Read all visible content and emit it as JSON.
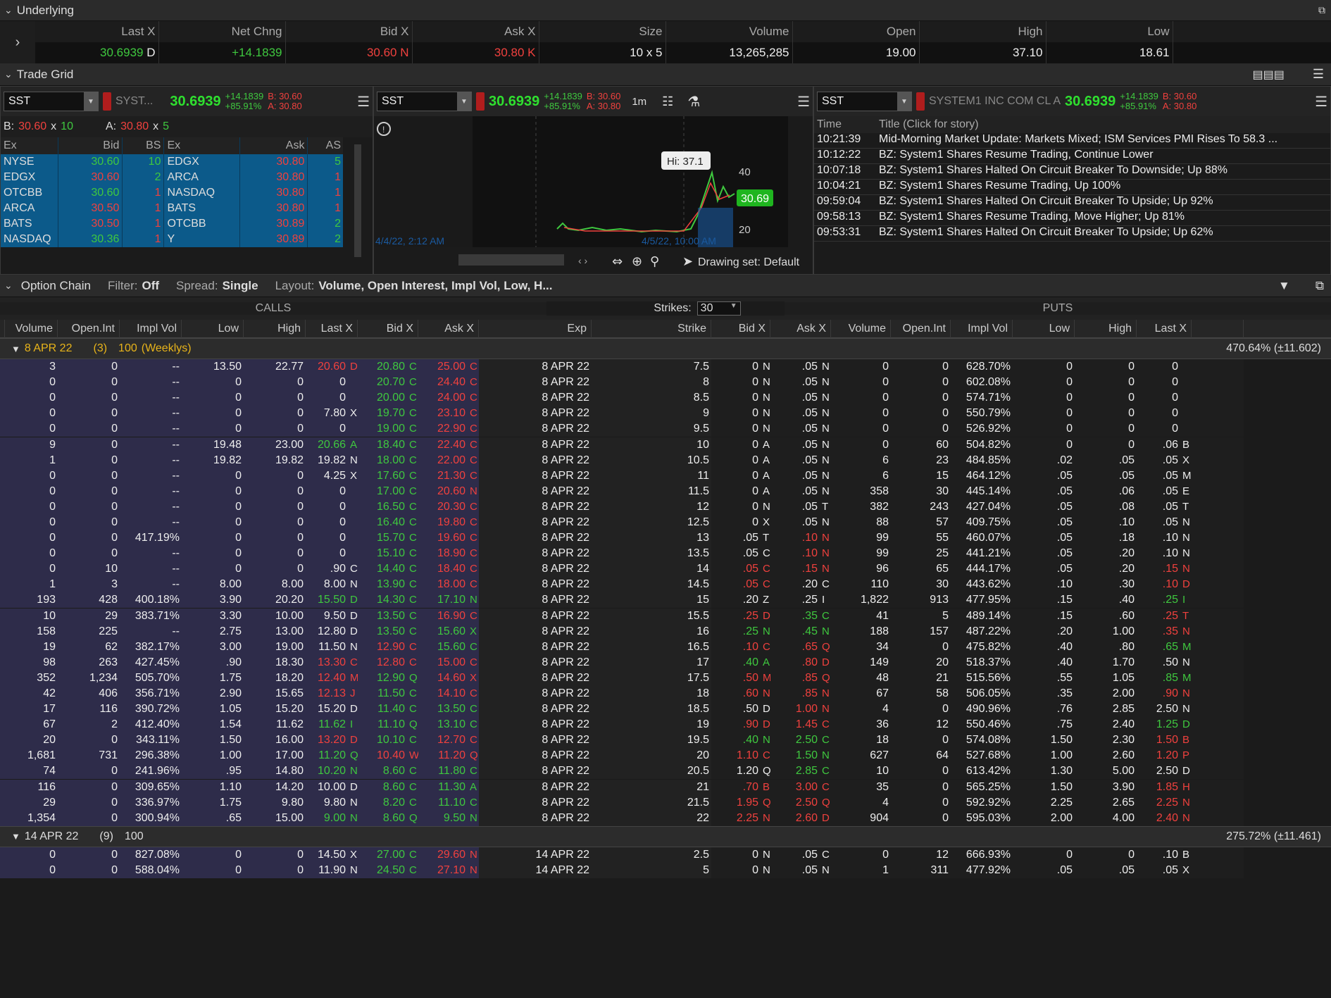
{
  "underlying": {
    "title": "Underlying",
    "headers": [
      "Last X",
      "Net Chng",
      "Bid X",
      "Ask X",
      "Size",
      "Volume",
      "Open",
      "High",
      "Low"
    ],
    "last": "30.6939",
    "last_ex": "D",
    "net_chng": "+14.1839",
    "bid": "30.60",
    "bid_ex": "N",
    "ask": "30.80",
    "ask_ex": "K",
    "size": "10 x 5",
    "volume": "13,265,285",
    "open": "19.00",
    "high": "37.10",
    "low": "18.61"
  },
  "trade_grid": {
    "title": "Trade Grid"
  },
  "level2": {
    "symbol": "SST",
    "name": "SYST...",
    "price": "30.6939",
    "chg": "+14.1839",
    "pct": "+85.91%",
    "b": "B: 30.60",
    "a": "A: 30.80",
    "bid_label": "B:",
    "bid_val": "30.60",
    "bid_x": "x",
    "bid_size": "10",
    "ask_label": "A:",
    "ask_val": "30.80",
    "ask_x": "x",
    "ask_size": "5",
    "headers": [
      "Ex",
      "Bid",
      "BS",
      "Ex",
      "Ask",
      "AS"
    ],
    "rows": [
      [
        "NYSE",
        "30.60",
        "10",
        "EDGX",
        "30.80",
        "5"
      ],
      [
        "EDGX",
        "30.60",
        "2",
        "ARCA",
        "30.80",
        "1"
      ],
      [
        "OTCBB",
        "30.60",
        "1",
        "NASDAQ",
        "30.80",
        "1"
      ],
      [
        "ARCA",
        "30.50",
        "1",
        "BATS",
        "30.80",
        "1"
      ],
      [
        "BATS",
        "30.50",
        "1",
        "OTCBB",
        "30.89",
        "2"
      ],
      [
        "NASDAQ",
        "30.36",
        "1",
        "Y",
        "30.89",
        "2"
      ]
    ]
  },
  "chart": {
    "symbol": "SST",
    "price": "30.6939",
    "chg": "+14.1839",
    "pct": "+85.91%",
    "b": "B: 30.60",
    "a": "A: 30.80",
    "interval": "1m",
    "hi_label": "Hi: 37.1",
    "y40": "40",
    "y20": "20",
    "last_tag": "30.69",
    "date1": "4/4/22, 2:12 AM",
    "date2": "4/5/22, 10:00 AM",
    "drawing": "Drawing set: Default"
  },
  "news": {
    "symbol": "SST",
    "name": "SYSTEM1 INC COM CL A",
    "price": "30.6939",
    "chg": "+14.1839",
    "pct": "+85.91%",
    "b": "B: 30.60",
    "a": "A: 30.80",
    "h_time": "Time",
    "h_title": "Title (Click for story)",
    "items": [
      [
        "10:21:39",
        "Mid-Morning Market Update: Markets Mixed; ISM Services PMI Rises To 58.3 ..."
      ],
      [
        "10:12:22",
        "BZ: System1 Shares Resume Trading, Continue Lower"
      ],
      [
        "10:07:18",
        "BZ: System1 Shares Halted On Circuit Breaker To Downside; Up 88%"
      ],
      [
        "10:04:21",
        "BZ: System1 Shares Resume Trading, Up 100%"
      ],
      [
        "09:59:04",
        "BZ: System1 Shares Halted On Circuit Breaker To Upside; Up 92%"
      ],
      [
        "09:58:13",
        "BZ: System1 Shares Resume Trading, Move Higher; Up 81%"
      ],
      [
        "09:53:31",
        "BZ: System1 Shares Halted On Circuit Breaker To Upside; Up 62%"
      ]
    ]
  },
  "option_chain": {
    "title": "Option Chain",
    "filter_label": "Filter:",
    "filter": "Off",
    "spread_label": "Spread:",
    "spread": "Single",
    "layout_label": "Layout:",
    "layout": "Volume, Open Interest, Impl Vol, Low, H...",
    "calls": "CALLS",
    "puts": "PUTS",
    "strikes_label": "Strikes:",
    "strikes": "30",
    "call_headers": [
      "Volume",
      "Open.Int",
      "Impl Vol",
      "Low",
      "High",
      "Last X",
      "Bid X",
      "Ask X"
    ],
    "exp_header": "Exp",
    "strike_header": "Strike",
    "put_headers": [
      "Bid X",
      "Ask X",
      "Volume",
      "Open.Int",
      "Impl Vol",
      "Low",
      "High",
      "Last X"
    ],
    "exp1": {
      "label": "8 APR 22",
      "count": "(3)",
      "mult": "100",
      "weekly": "(Weeklys)",
      "iv": "470.64% (±11.602)"
    },
    "exp2": {
      "label": "14 APR 22",
      "count": "(9)",
      "mult": "100",
      "iv": "275.72% (±11.461)"
    },
    "rows": [
      [
        "3",
        "0",
        "--",
        "13.50",
        "22.77",
        "20.60",
        "D",
        "20.80",
        "C",
        "25.00",
        "C",
        "8 APR 22",
        "7.5",
        "0",
        "N",
        ".05",
        "N",
        "0",
        "0",
        "628.70%",
        "0",
        "0",
        "0",
        ""
      ],
      [
        "0",
        "0",
        "--",
        "0",
        "0",
        "0",
        "",
        "20.70",
        "C",
        "24.40",
        "C",
        "8 APR 22",
        "8",
        "0",
        "N",
        ".05",
        "N",
        "0",
        "0",
        "602.08%",
        "0",
        "0",
        "0",
        ""
      ],
      [
        "0",
        "0",
        "--",
        "0",
        "0",
        "0",
        "",
        "20.00",
        "C",
        "24.00",
        "C",
        "8 APR 22",
        "8.5",
        "0",
        "N",
        ".05",
        "N",
        "0",
        "0",
        "574.71%",
        "0",
        "0",
        "0",
        ""
      ],
      [
        "0",
        "0",
        "--",
        "0",
        "0",
        "7.80",
        "X",
        "19.70",
        "C",
        "23.10",
        "C",
        "8 APR 22",
        "9",
        "0",
        "N",
        ".05",
        "N",
        "0",
        "0",
        "550.79%",
        "0",
        "0",
        "0",
        ""
      ],
      [
        "0",
        "0",
        "--",
        "0",
        "0",
        "0",
        "",
        "19.00",
        "C",
        "22.90",
        "C",
        "8 APR 22",
        "9.5",
        "0",
        "N",
        ".05",
        "N",
        "0",
        "0",
        "526.92%",
        "0",
        "0",
        "0",
        ""
      ],
      [
        "9",
        "0",
        "--",
        "19.48",
        "23.00",
        "20.66",
        "A",
        "18.40",
        "C",
        "22.40",
        "C",
        "8 APR 22",
        "10",
        "0",
        "A",
        ".05",
        "N",
        "0",
        "60",
        "504.82%",
        "0",
        "0",
        ".06",
        "B"
      ],
      [
        "1",
        "0",
        "--",
        "19.82",
        "19.82",
        "19.82",
        "N",
        "18.00",
        "C",
        "22.00",
        "C",
        "8 APR 22",
        "10.5",
        "0",
        "A",
        ".05",
        "N",
        "6",
        "23",
        "484.85%",
        ".02",
        ".05",
        ".05",
        "X"
      ],
      [
        "0",
        "0",
        "--",
        "0",
        "0",
        "4.25",
        "X",
        "17.60",
        "C",
        "21.30",
        "C",
        "8 APR 22",
        "11",
        "0",
        "A",
        ".05",
        "N",
        "6",
        "15",
        "464.12%",
        ".05",
        ".05",
        ".05",
        "M"
      ],
      [
        "0",
        "0",
        "--",
        "0",
        "0",
        "0",
        "",
        "17.00",
        "C",
        "20.60",
        "N",
        "8 APR 22",
        "11.5",
        "0",
        "A",
        ".05",
        "N",
        "358",
        "30",
        "445.14%",
        ".05",
        ".06",
        ".05",
        "E"
      ],
      [
        "0",
        "0",
        "--",
        "0",
        "0",
        "0",
        "",
        "16.50",
        "C",
        "20.30",
        "C",
        "8 APR 22",
        "12",
        "0",
        "N",
        ".05",
        "T",
        "382",
        "243",
        "427.04%",
        ".05",
        ".08",
        ".05",
        "T"
      ],
      [
        "0",
        "0",
        "--",
        "0",
        "0",
        "0",
        "",
        "16.40",
        "C",
        "19.80",
        "C",
        "8 APR 22",
        "12.5",
        "0",
        "X",
        ".05",
        "N",
        "88",
        "57",
        "409.75%",
        ".05",
        ".10",
        ".05",
        "N"
      ],
      [
        "0",
        "0",
        "417.19%",
        "0",
        "0",
        "0",
        "",
        "15.70",
        "C",
        "19.60",
        "C",
        "8 APR 22",
        "13",
        ".05",
        "T",
        ".10",
        "N",
        "99",
        "55",
        "460.07%",
        ".05",
        ".18",
        ".10",
        "N"
      ],
      [
        "0",
        "0",
        "--",
        "0",
        "0",
        "0",
        "",
        "15.10",
        "C",
        "18.90",
        "C",
        "8 APR 22",
        "13.5",
        ".05",
        "C",
        ".10",
        "N",
        "99",
        "25",
        "441.21%",
        ".05",
        ".20",
        ".10",
        "N"
      ],
      [
        "0",
        "10",
        "--",
        "0",
        "0",
        ".90",
        "C",
        "14.40",
        "C",
        "18.40",
        "C",
        "8 APR 22",
        "14",
        ".05",
        "C",
        ".15",
        "N",
        "96",
        "65",
        "444.17%",
        ".05",
        ".20",
        ".15",
        "N"
      ],
      [
        "1",
        "3",
        "--",
        "8.00",
        "8.00",
        "8.00",
        "N",
        "13.90",
        "C",
        "18.00",
        "C",
        "8 APR 22",
        "14.5",
        ".05",
        "C",
        ".20",
        "C",
        "110",
        "30",
        "443.62%",
        ".10",
        ".30",
        ".10",
        "D"
      ],
      [
        "193",
        "428",
        "400.18%",
        "3.90",
        "20.20",
        "15.50",
        "D",
        "14.30",
        "C",
        "17.10",
        "N",
        "8 APR 22",
        "15",
        ".20",
        "Z",
        ".25",
        "I",
        "1,822",
        "913",
        "477.95%",
        ".15",
        ".40",
        ".25",
        "I"
      ],
      [
        "10",
        "29",
        "383.71%",
        "3.30",
        "10.00",
        "9.50",
        "D",
        "13.50",
        "C",
        "16.90",
        "C",
        "8 APR 22",
        "15.5",
        ".25",
        "D",
        ".35",
        "C",
        "41",
        "5",
        "489.14%",
        ".15",
        ".60",
        ".25",
        "T"
      ],
      [
        "158",
        "225",
        "--",
        "2.75",
        "13.00",
        "12.80",
        "D",
        "13.50",
        "C",
        "15.60",
        "X",
        "8 APR 22",
        "16",
        ".25",
        "N",
        ".45",
        "N",
        "188",
        "157",
        "487.22%",
        ".20",
        "1.00",
        ".35",
        "N"
      ],
      [
        "19",
        "62",
        "382.17%",
        "3.00",
        "19.00",
        "11.50",
        "N",
        "12.90",
        "C",
        "15.60",
        "C",
        "8 APR 22",
        "16.5",
        ".10",
        "C",
        ".65",
        "Q",
        "34",
        "0",
        "475.82%",
        ".40",
        ".80",
        ".65",
        "M"
      ],
      [
        "98",
        "263",
        "427.45%",
        ".90",
        "18.30",
        "13.30",
        "C",
        "12.80",
        "C",
        "15.00",
        "C",
        "8 APR 22",
        "17",
        ".40",
        "A",
        ".80",
        "D",
        "149",
        "20",
        "518.37%",
        ".40",
        "1.70",
        ".50",
        "N"
      ],
      [
        "352",
        "1,234",
        "505.70%",
        "1.75",
        "18.20",
        "12.40",
        "M",
        "12.90",
        "Q",
        "14.60",
        "X",
        "8 APR 22",
        "17.5",
        ".50",
        "M",
        ".85",
        "Q",
        "48",
        "21",
        "515.56%",
        ".55",
        "1.05",
        ".85",
        "M"
      ],
      [
        "42",
        "406",
        "356.71%",
        "2.90",
        "15.65",
        "12.13",
        "J",
        "11.50",
        "C",
        "14.10",
        "C",
        "8 APR 22",
        "18",
        ".60",
        "N",
        ".85",
        "N",
        "67",
        "58",
        "506.05%",
        ".35",
        "2.00",
        ".90",
        "N"
      ],
      [
        "17",
        "116",
        "390.72%",
        "1.05",
        "15.20",
        "15.20",
        "D",
        "11.40",
        "C",
        "13.50",
        "C",
        "8 APR 22",
        "18.5",
        ".50",
        "D",
        "1.00",
        "N",
        "4",
        "0",
        "490.96%",
        ".76",
        "2.85",
        "2.50",
        "N"
      ],
      [
        "67",
        "2",
        "412.40%",
        "1.54",
        "11.62",
        "11.62",
        "I",
        "11.10",
        "Q",
        "13.10",
        "C",
        "8 APR 22",
        "19",
        ".90",
        "D",
        "1.45",
        "C",
        "36",
        "12",
        "550.46%",
        ".75",
        "2.40",
        "1.25",
        "D"
      ],
      [
        "20",
        "0",
        "343.11%",
        "1.50",
        "16.00",
        "13.20",
        "D",
        "10.10",
        "C",
        "12.70",
        "C",
        "8 APR 22",
        "19.5",
        ".40",
        "N",
        "2.50",
        "C",
        "18",
        "0",
        "574.08%",
        "1.50",
        "2.30",
        "1.50",
        "B"
      ],
      [
        "1,681",
        "731",
        "296.38%",
        "1.00",
        "17.00",
        "11.20",
        "Q",
        "10.40",
        "W",
        "11.20",
        "Q",
        "8 APR 22",
        "20",
        "1.10",
        "C",
        "1.50",
        "N",
        "627",
        "64",
        "527.68%",
        "1.00",
        "2.60",
        "1.20",
        "P"
      ],
      [
        "74",
        "0",
        "241.96%",
        ".95",
        "14.80",
        "10.20",
        "N",
        "8.60",
        "C",
        "11.80",
        "C",
        "8 APR 22",
        "20.5",
        "1.20",
        "Q",
        "2.85",
        "C",
        "10",
        "0",
        "613.42%",
        "1.30",
        "5.00",
        "2.50",
        "D"
      ],
      [
        "116",
        "0",
        "309.65%",
        "1.10",
        "14.20",
        "10.00",
        "D",
        "8.60",
        "C",
        "11.30",
        "A",
        "8 APR 22",
        "21",
        ".70",
        "B",
        "3.00",
        "C",
        "35",
        "0",
        "565.25%",
        "1.50",
        "3.90",
        "1.85",
        "H"
      ],
      [
        "29",
        "0",
        "336.97%",
        "1.75",
        "9.80",
        "9.80",
        "N",
        "8.20",
        "C",
        "11.10",
        "C",
        "8 APR 22",
        "21.5",
        "1.95",
        "Q",
        "2.50",
        "Q",
        "4",
        "0",
        "592.92%",
        "2.25",
        "2.65",
        "2.25",
        "N"
      ],
      [
        "1,354",
        "0",
        "300.94%",
        ".65",
        "15.00",
        "9.00",
        "N",
        "8.60",
        "Q",
        "9.50",
        "N",
        "8 APR 22",
        "22",
        "2.25",
        "N",
        "2.60",
        "D",
        "904",
        "0",
        "595.03%",
        "2.00",
        "4.00",
        "2.40",
        "N"
      ]
    ],
    "rows2": [
      [
        "0",
        "0",
        "827.08%",
        "0",
        "0",
        "14.50",
        "X",
        "27.00",
        "C",
        "29.60",
        "N",
        "14 APR 22",
        "2.5",
        "0",
        "N",
        ".05",
        "C",
        "0",
        "12",
        "666.93%",
        "0",
        "0",
        ".10",
        "B"
      ],
      [
        "0",
        "0",
        "588.04%",
        "0",
        "0",
        "11.90",
        "N",
        "24.50",
        "C",
        "27.10",
        "N",
        "14 APR 22",
        "5",
        "0",
        "N",
        ".05",
        "N",
        "1",
        "311",
        "477.92%",
        ".05",
        ".05",
        ".05",
        "X"
      ]
    ]
  },
  "colors": {
    "green": "#3fc83f",
    "red": "#f0413e",
    "blue": "#0c5a8a",
    "call_bg": "#2e2c4a",
    "weekly": "#e8b41a"
  },
  "row_colors": [
    [
      "r",
      "g",
      "r",
      "w",
      "w"
    ],
    [
      "w",
      "g",
      "r",
      "w",
      "w"
    ],
    [
      "w",
      "g",
      "r",
      "w",
      "w"
    ],
    [
      "w",
      "g",
      "r",
      "w",
      "w"
    ],
    [
      "w",
      "g",
      "r",
      "w",
      "w"
    ],
    [
      "g",
      "g",
      "r",
      "w",
      "w"
    ],
    [
      "w",
      "g",
      "r",
      "w",
      "w"
    ],
    [
      "w",
      "g",
      "r",
      "w",
      "w"
    ],
    [
      "w",
      "g",
      "r",
      "w",
      "w"
    ],
    [
      "w",
      "g",
      "r",
      "w",
      "w"
    ],
    [
      "w",
      "g",
      "r",
      "w",
      "w"
    ],
    [
      "w",
      "g",
      "r",
      "w",
      "r"
    ],
    [
      "w",
      "g",
      "r",
      "w",
      "r"
    ],
    [
      "w",
      "g",
      "r",
      "r",
      "r"
    ],
    [
      "w",
      "g",
      "r",
      "r",
      "w"
    ],
    [
      "g",
      "g",
      "g",
      "w",
      "w"
    ],
    [
      "w",
      "g",
      "r",
      "r",
      "g"
    ],
    [
      "w",
      "g",
      "g",
      "g",
      "g"
    ],
    [
      "w",
      "r",
      "g",
      "r",
      "r"
    ],
    [
      "r",
      "r",
      "r",
      "g",
      "r"
    ],
    [
      "r",
      "g",
      "r",
      "r",
      "r"
    ],
    [
      "r",
      "g",
      "r",
      "r",
      "r"
    ],
    [
      "w",
      "g",
      "g",
      "w",
      "r"
    ],
    [
      "g",
      "g",
      "g",
      "r",
      "r"
    ],
    [
      "r",
      "g",
      "r",
      "g",
      "g"
    ],
    [
      "g",
      "r",
      "r",
      "r",
      "g"
    ],
    [
      "g",
      "g",
      "g",
      "w",
      "g"
    ],
    [
      "w",
      "g",
      "g",
      "r",
      "r"
    ],
    [
      "w",
      "g",
      "g",
      "r",
      "r"
    ],
    [
      "g",
      "g",
      "g",
      "r",
      "r"
    ]
  ],
  "put_last_colors": [
    "w",
    "w",
    "w",
    "w",
    "w",
    "w",
    "w",
    "w",
    "w",
    "w",
    "w",
    "w",
    "w",
    "r",
    "r",
    "g",
    "r",
    "r",
    "g",
    "w",
    "g",
    "r",
    "w",
    "g",
    "r",
    "r",
    "w",
    "r",
    "r",
    "r"
  ]
}
